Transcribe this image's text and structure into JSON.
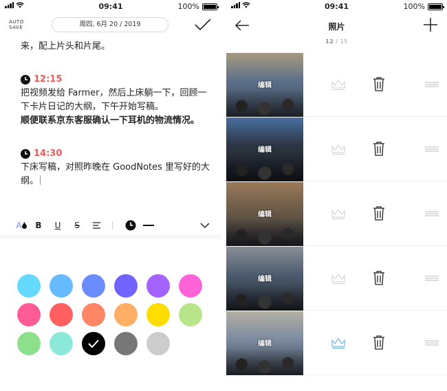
{
  "status": {
    "time": "09:41",
    "battery": "100%"
  },
  "editor": {
    "autosave": [
      "AUTO",
      "SAVE"
    ],
    "date": "周四, 6月 20 / 2019",
    "intro": "来，配上片头和片尾。",
    "entries": [
      {
        "time": "12:15",
        "text": "把视频发给 Farmer，然后上床躺一下，回顾一下卡片日记的大纲，下午开始写稿。",
        "bold_text": "顺便联系京东客服确认一下耳机的物流情况。"
      },
      {
        "time": "14:30",
        "text": "下床写稿，对照昨晚在 GoodNotes 里写好的大纲。",
        "bold_text": ""
      }
    ],
    "toolbar": {
      "bold": "B",
      "underline": "U",
      "strike": "S"
    }
  },
  "palette": [
    "#66d9ff",
    "#66bbff",
    "#6b8cff",
    "#7063ff",
    "#a463ff",
    "#ff63d8",
    "#ff5c95",
    "#ff5f5f",
    "#ff8664",
    "#ffae66",
    "#ffdd00",
    "#b8e58a",
    "#8ce08c",
    "#8ce8d8",
    "#000000",
    "#777777",
    "#cccccc"
  ],
  "selected_color": "#000000",
  "photos": {
    "title": "照片",
    "count_current": "12",
    "count_total": "/ 15",
    "edit_label": "编辑",
    "items": [
      {
        "cover": false
      },
      {
        "cover": false
      },
      {
        "cover": false
      },
      {
        "cover": false
      },
      {
        "cover": true
      }
    ]
  }
}
